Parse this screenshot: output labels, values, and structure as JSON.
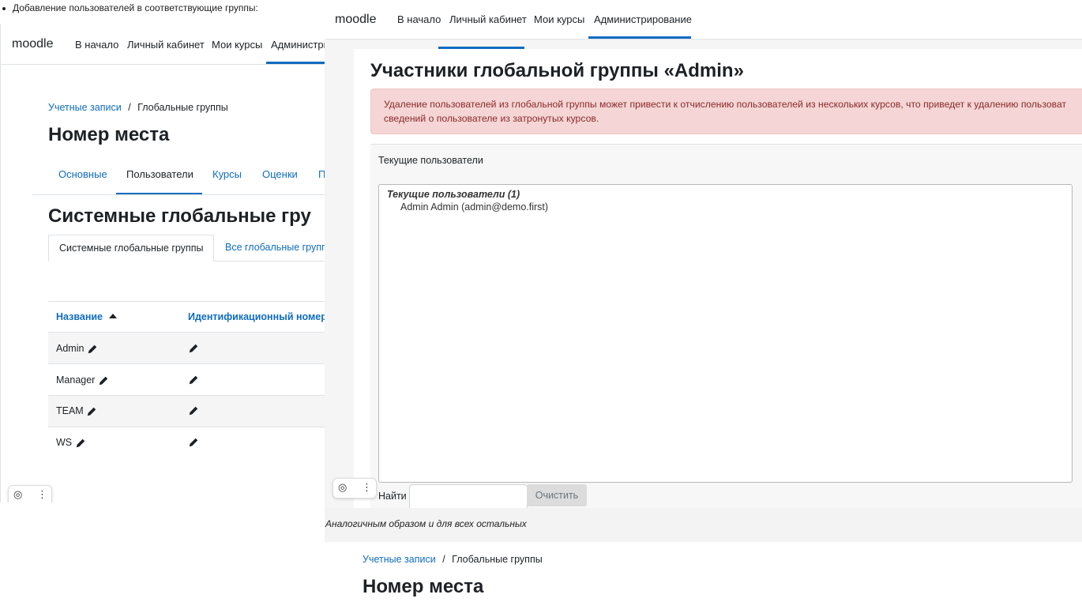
{
  "doc": {
    "bullet_text": "Добавление пользователей в соответствующие группы:",
    "caption": "Аналогичным образом и для всех остальных"
  },
  "left": {
    "brand": "moodle",
    "nav": [
      "В начало",
      "Личный кабинет",
      "Мои курсы",
      "Администри"
    ],
    "breadcrumb": {
      "link": "Учетные записи",
      "sep": "/",
      "current": "Глобальные группы"
    },
    "page_title": "Номер места",
    "tabs": [
      "Основные",
      "Пользователи",
      "Курсы",
      "Оценки",
      "П"
    ],
    "section_title": "Системные глобальные гру",
    "subtabs": [
      "Системные глобальные группы",
      "Все глобальные групп"
    ],
    "table": {
      "headers": [
        "Название",
        "Идентификационный номер"
      ],
      "rows": [
        {
          "name": "Admin"
        },
        {
          "name": "Manager"
        },
        {
          "name": "TEAM"
        },
        {
          "name": "WS"
        }
      ]
    }
  },
  "right": {
    "brand": "moodle",
    "nav": [
      "В начало",
      "Личный кабинет",
      "Мои курсы",
      "Администрирование"
    ],
    "title": "Участники глобальной группы «Admin»",
    "alert_line1": "Удаление пользователей из глобальной группы может привести к отчислению пользователей из нескольких курсов, что приведет к удалению пользоват",
    "alert_line2": "сведений о пользователе из затронутых курсов.",
    "current_users_label": "Текущие пользователи",
    "list_group": "Текущие пользователи (1)",
    "list_item": "Admin Admin (admin@demo.first)",
    "search_label": "Найти",
    "search_value": "",
    "clear_button": "Очистить"
  },
  "bottom": {
    "breadcrumb": {
      "link": "Учетные записи",
      "sep": "/",
      "current": "Глобальные группы"
    },
    "page_title": "Номер места"
  },
  "widget": {
    "camera_icon": "◎",
    "menu_icon": "⋮"
  },
  "colors": {
    "link": "#0f6cbf",
    "alert_bg": "#f5d5d5",
    "alert_text": "#8a2a2a"
  }
}
